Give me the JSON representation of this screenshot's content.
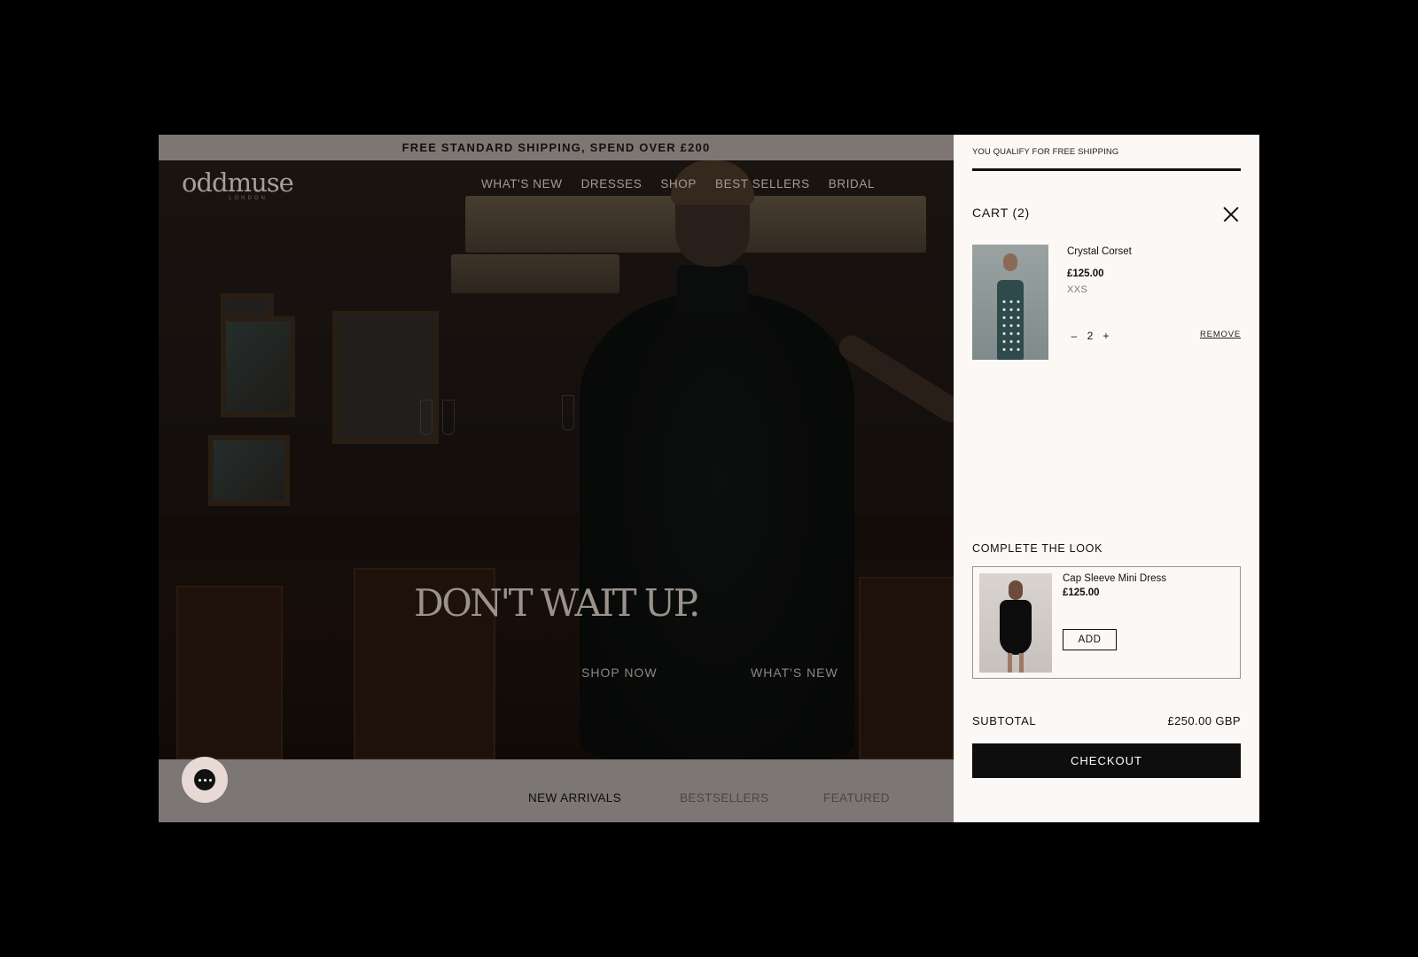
{
  "announcement": "FREE STANDARD SHIPPING, SPEND OVER £200",
  "brand": {
    "name": "oddmuse",
    "sub": "LONDON"
  },
  "nav": [
    "WHAT'S NEW",
    "DRESSES",
    "SHOP",
    "BEST SELLERS",
    "BRIDAL"
  ],
  "hero": {
    "title": "DON'T WAIT UP.",
    "cta_primary": "SHOP NOW",
    "cta_secondary": "WHAT'S NEW"
  },
  "tabs": [
    {
      "label": "NEW ARRIVALS",
      "active": true
    },
    {
      "label": "BESTSELLERS",
      "active": false
    },
    {
      "label": "FEATURED",
      "active": false
    }
  ],
  "cart": {
    "shipping_message": "YOU QUALIFY FOR FREE SHIPPING",
    "shipping_progress": 1.0,
    "title": "CART (2)",
    "items": [
      {
        "name": "Crystal Corset",
        "price": "£125.00",
        "size": "XXS",
        "quantity": "2",
        "remove_label": "REMOVE"
      }
    ],
    "complete_the_look": {
      "title": "COMPLETE THE LOOK",
      "product": {
        "name": "Cap Sleeve Mini Dress",
        "price": "£125.00",
        "add_label": "ADD"
      }
    },
    "subtotal_label": "SUBTOTAL",
    "subtotal_value": "£250.00 GBP",
    "checkout_label": "CHECKOUT"
  },
  "colors": {
    "accent": "#0e0e0e",
    "drawer_bg": "#fbf8f5",
    "announcement_bg": "#7e7672",
    "chat_button": "#e8d9d6"
  },
  "icons": {
    "close": "close-icon",
    "chat": "chat-bubble-icon",
    "minus": "minus-icon",
    "plus": "plus-icon"
  }
}
